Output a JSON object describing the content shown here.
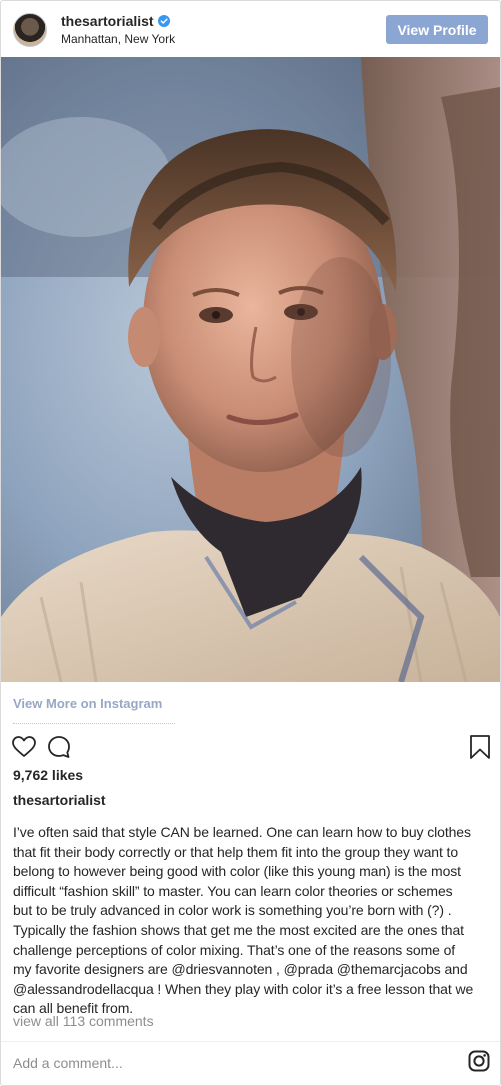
{
  "header": {
    "username": "thesartorialist",
    "location": "Manhattan, New York",
    "view_profile_label": "View Profile",
    "verified": true
  },
  "post": {
    "view_more_label": "View More on Instagram",
    "likes": "9,762 likes",
    "caption_user": "thesartorialist",
    "caption_lines": [
      "I’ve often said that style CAN be learned. One can learn how to buy clothes",
      "that fit their body correctly or that help them fit into the group they want to",
      "belong to however being good with color (like this young man) is the most",
      "difficult “fashion skill” to master. You can learn color theories or schemes",
      "but to be truly advanced in color work is something you’re born with (?) .",
      "Typically the fashion shows that get me the most excited are the ones that",
      "challenge perceptions of color mixing. That’s one of the reasons some of",
      "my favorite designers are @driesvannoten , @prada @themarcjacobs and",
      "@alessandrodellacqua ! When they play with color it’s a free lesson that we",
      "can all benefit from."
    ],
    "view_all_comments": "view all 113 comments",
    "add_comment_placeholder": "Add a comment..."
  },
  "icons": {
    "avatar": "profile-avatar",
    "verified": "verified-badge-icon",
    "like": "heart-icon",
    "comment": "comment-icon",
    "save": "bookmark-icon",
    "brand": "instagram-logo-icon"
  },
  "colors": {
    "view_profile_bg": "#8ca6d4",
    "view_more_link": "#97a8c6",
    "verified": "#3897f0",
    "muted_text": "#8e8e8e"
  }
}
